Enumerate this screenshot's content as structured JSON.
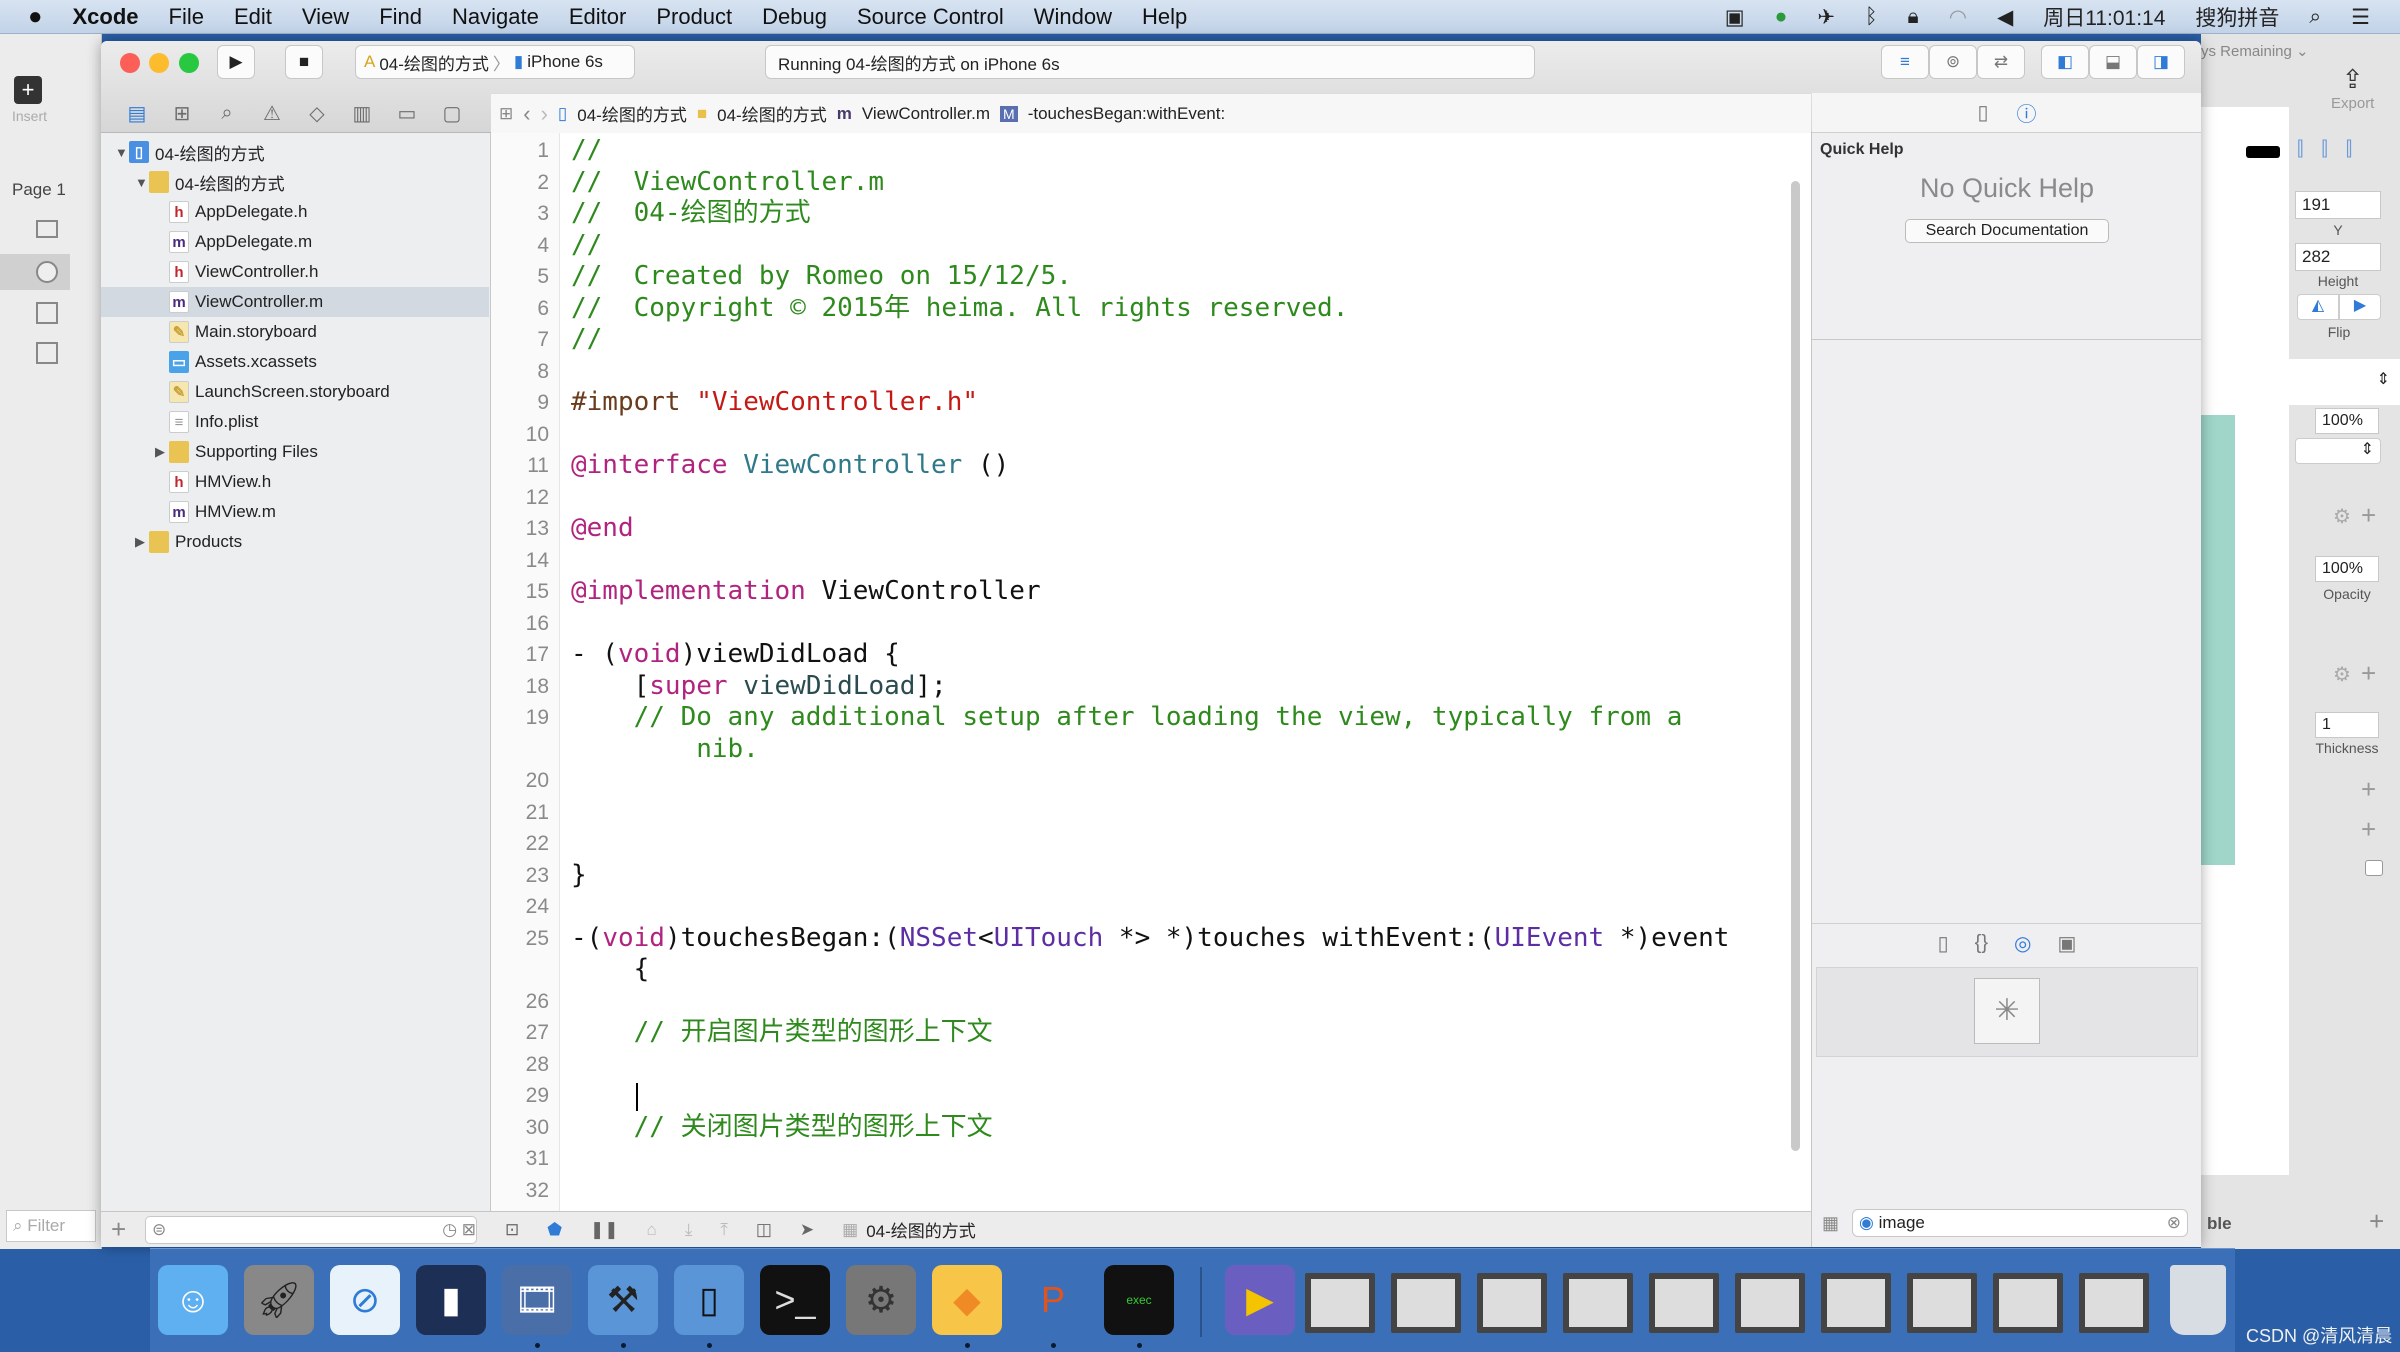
{
  "menubar": {
    "apple": "",
    "app": "Xcode",
    "items": [
      "File",
      "Edit",
      "View",
      "Find",
      "Navigate",
      "Editor",
      "Product",
      "Debug",
      "Source Control",
      "Window",
      "Help"
    ],
    "clock": "周日11:01:14",
    "input_method": "搜狗拼音"
  },
  "toolbar": {
    "scheme": "04-绘图的方式",
    "device": "iPhone 6s",
    "activity": "Running 04-绘图的方式 on iPhone 6s"
  },
  "jumpbar": [
    "04-绘图的方式",
    "04-绘图的方式",
    "ViewController.m",
    "-touchesBegan:withEvent:"
  ],
  "navigator": {
    "items": [
      {
        "label": "04-绘图的方式",
        "level": 0,
        "kind": "project",
        "expanded": true
      },
      {
        "label": "04-绘图的方式",
        "level": 1,
        "kind": "folder",
        "expanded": true
      },
      {
        "label": "AppDelegate.h",
        "level": 2,
        "kind": "h"
      },
      {
        "label": "AppDelegate.m",
        "level": 2,
        "kind": "m"
      },
      {
        "label": "ViewController.h",
        "level": 2,
        "kind": "h"
      },
      {
        "label": "ViewController.m",
        "level": 2,
        "kind": "m",
        "selected": true
      },
      {
        "label": "Main.storyboard",
        "level": 2,
        "kind": "storyboard"
      },
      {
        "label": "Assets.xcassets",
        "level": 2,
        "kind": "assets"
      },
      {
        "label": "LaunchScreen.storyboard",
        "level": 2,
        "kind": "storyboard"
      },
      {
        "label": "Info.plist",
        "level": 2,
        "kind": "plist"
      },
      {
        "label": "Supporting Files",
        "level": 2,
        "kind": "folder",
        "expanded": false
      },
      {
        "label": "HMView.h",
        "level": 2,
        "kind": "h"
      },
      {
        "label": "HMView.m",
        "level": 2,
        "kind": "m"
      },
      {
        "label": "Products",
        "level": 1,
        "kind": "folder",
        "expanded": false
      }
    ]
  },
  "editor": {
    "cursor_line": "28",
    "lines": [
      {
        "num": "1",
        "segs": [
          [
            "//",
            "c"
          ]
        ]
      },
      {
        "num": "2",
        "segs": [
          [
            "//  ViewController.m",
            "c"
          ]
        ]
      },
      {
        "num": "3",
        "segs": [
          [
            "//  04-绘图的方式",
            "c"
          ]
        ]
      },
      {
        "num": "4",
        "segs": [
          [
            "//",
            "c"
          ]
        ]
      },
      {
        "num": "5",
        "segs": [
          [
            "//  Created by Romeo on 15/12/5.",
            "c"
          ]
        ]
      },
      {
        "num": "6",
        "segs": [
          [
            "//  Copyright © 2015年 heima. All rights reserved.",
            "c"
          ]
        ]
      },
      {
        "num": "7",
        "segs": [
          [
            "//",
            "c"
          ]
        ]
      },
      {
        "num": "8",
        "segs": []
      },
      {
        "num": "9",
        "segs": [
          [
            "#import ",
            "p"
          ],
          [
            "\"ViewController.h\"",
            "s"
          ]
        ]
      },
      {
        "num": "10",
        "segs": []
      },
      {
        "num": "11",
        "segs": [
          [
            "@interface ",
            "k"
          ],
          [
            "ViewController",
            "pr"
          ],
          [
            " ()",
            "n"
          ]
        ]
      },
      {
        "num": "12",
        "segs": []
      },
      {
        "num": "13",
        "segs": [
          [
            "@end",
            "k"
          ]
        ]
      },
      {
        "num": "14",
        "segs": []
      },
      {
        "num": "15",
        "segs": [
          [
            "@implementation",
            "k"
          ],
          [
            " ViewController",
            "n"
          ]
        ]
      },
      {
        "num": "16",
        "segs": []
      },
      {
        "num": "17",
        "segs": [
          [
            "- (",
            "n"
          ],
          [
            "void",
            "k"
          ],
          [
            ")viewDidLoad {",
            "n"
          ]
        ]
      },
      {
        "num": "18",
        "segs": [
          [
            "    [",
            "n"
          ],
          [
            "super",
            "k"
          ],
          [
            " viewDidLoad",
            "m"
          ],
          [
            "];",
            "n"
          ]
        ]
      },
      {
        "num": "19",
        "segs": [
          [
            "    // Do any additional setup after loading the view, typically from a",
            "c"
          ]
        ]
      },
      {
        "num": "",
        "segs": [
          [
            "        nib.",
            "c"
          ]
        ]
      },
      {
        "num": "20",
        "segs": []
      },
      {
        "num": "21",
        "segs": []
      },
      {
        "num": "22",
        "segs": []
      },
      {
        "num": "23",
        "segs": [
          [
            "}",
            "n"
          ]
        ]
      },
      {
        "num": "24",
        "segs": []
      },
      {
        "num": "25",
        "segs": [
          [
            "-(",
            "n"
          ],
          [
            "void",
            "k"
          ],
          [
            ")touchesBegan:(",
            "n"
          ],
          [
            "NSSet",
            "t"
          ],
          [
            "<",
            "n"
          ],
          [
            "UITouch",
            "t"
          ],
          [
            " *> *)touches withEvent:(",
            "n"
          ],
          [
            "UIEvent",
            "t"
          ],
          [
            " *)event",
            "n"
          ]
        ]
      },
      {
        "num": "",
        "segs": [
          [
            "    {",
            "n"
          ]
        ]
      },
      {
        "num": "26",
        "segs": []
      },
      {
        "num": "27",
        "segs": [
          [
            "    // 开启图片类型的图形上下文",
            "c"
          ]
        ]
      },
      {
        "num": "28",
        "segs": []
      },
      {
        "num": "29",
        "segs": []
      },
      {
        "num": "30",
        "segs": [
          [
            "    // 关闭图片类型的图形上下文",
            "c"
          ]
        ]
      },
      {
        "num": "31",
        "segs": []
      },
      {
        "num": "32",
        "segs": []
      }
    ]
  },
  "debugbar": {
    "target": "04-绘图的方式"
  },
  "inspector": {
    "title": "Quick Help",
    "empty": "No Quick Help",
    "search_button": "Search Documentation",
    "filter_value": "image"
  },
  "sketch": {
    "insert": "Insert",
    "page": "Page 1",
    "filter_placeholder": "Filter",
    "remaining": "ys Remaining",
    "export": "Export",
    "y_value": "191",
    "y_label": "Y",
    "height_value": "282",
    "height_label": "Height",
    "flip_label": "Flip",
    "pct1": "100%",
    "opacity_value": "100%",
    "opacity_label": "Opacity",
    "thickness_value": "1",
    "thickness_label": "Thickness",
    "bottom_text": "ble"
  },
  "dock": {
    "apps": [
      "finder",
      "launchpad",
      "safari",
      "mouse-app",
      "photo-slideshow",
      "xcode",
      "simulator",
      "terminal",
      "system-preferences",
      "sketch",
      "p-app",
      "console"
    ],
    "running": [
      false,
      false,
      false,
      false,
      true,
      true,
      true,
      false,
      false,
      true,
      true,
      true
    ]
  },
  "watermark": "CSDN @清风清晨",
  "colors": {
    "accent": "#2f7bd6",
    "comment": "#2f8a1e",
    "keyword": "#b0247f",
    "string": "#c41a16"
  }
}
